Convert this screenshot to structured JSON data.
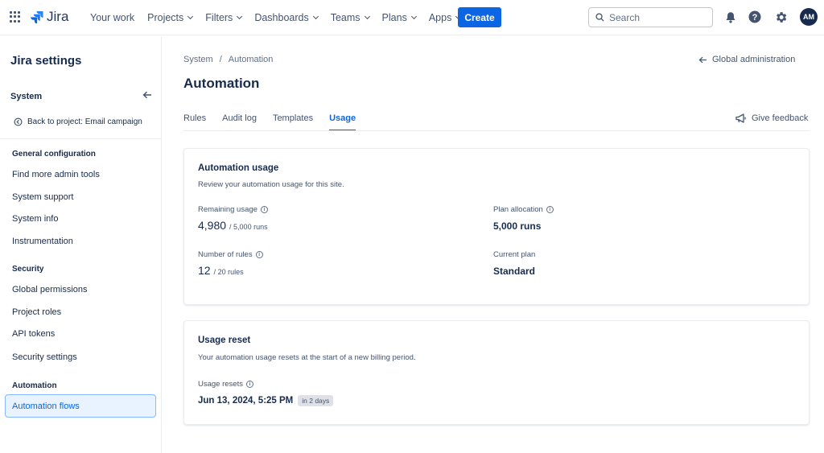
{
  "topnav": {
    "brand": "Jira",
    "items": [
      {
        "label": "Your work",
        "dropdown": false
      },
      {
        "label": "Projects",
        "dropdown": true
      },
      {
        "label": "Filters",
        "dropdown": true
      },
      {
        "label": "Dashboards",
        "dropdown": true
      },
      {
        "label": "Teams",
        "dropdown": true
      },
      {
        "label": "Plans",
        "dropdown": true
      },
      {
        "label": "Apps",
        "dropdown": true
      }
    ],
    "create_label": "Create",
    "search_placeholder": "Search",
    "avatar_initials": "AM",
    "icons": [
      "notifications-icon",
      "help-icon",
      "settings-icon"
    ]
  },
  "sidebar": {
    "title": "Jira settings",
    "system_label": "System",
    "back_to_project": "Back to project: Email campaign",
    "sections": [
      {
        "heading": "General configuration",
        "items": [
          "Find more admin tools",
          "System support",
          "System info",
          "Instrumentation"
        ]
      },
      {
        "heading": "Security",
        "items": [
          "Global permissions",
          "Project roles",
          "API tokens",
          "Security settings"
        ]
      },
      {
        "heading": "Automation",
        "items": [
          "Automation flows"
        ]
      }
    ],
    "active_item": "Automation flows"
  },
  "main": {
    "breadcrumb": [
      "System",
      "Automation"
    ],
    "breadcrumb_sep": "/",
    "global_admin": "Global administration",
    "title": "Automation",
    "tabs": [
      "Rules",
      "Audit log",
      "Templates",
      "Usage"
    ],
    "active_tab": "Usage",
    "feedback": "Give feedback",
    "usage_card": {
      "title": "Automation usage",
      "desc": "Review your automation usage for this site.",
      "remaining_label": "Remaining usage",
      "remaining_value": "4,980",
      "remaining_total": "/ 5,000 runs",
      "plan_alloc_label": "Plan allocation",
      "plan_alloc_value": "5,000 runs",
      "rules_label": "Number of rules",
      "rules_value": "12",
      "rules_total": "/ 20 rules",
      "plan_label": "Current plan",
      "plan_value": "Standard"
    },
    "reset_card": {
      "title": "Usage reset",
      "desc": "Your automation usage resets at the start of a new billing period.",
      "resets_label": "Usage resets",
      "resets_value": "Jun 13, 2024, 5:25 PM",
      "resets_badge": "in 2 days"
    }
  },
  "colors": {
    "primary": "#0c66e4",
    "text": "#172b4d",
    "subtle": "#44546f",
    "active_bg": "#e9f2ff"
  }
}
